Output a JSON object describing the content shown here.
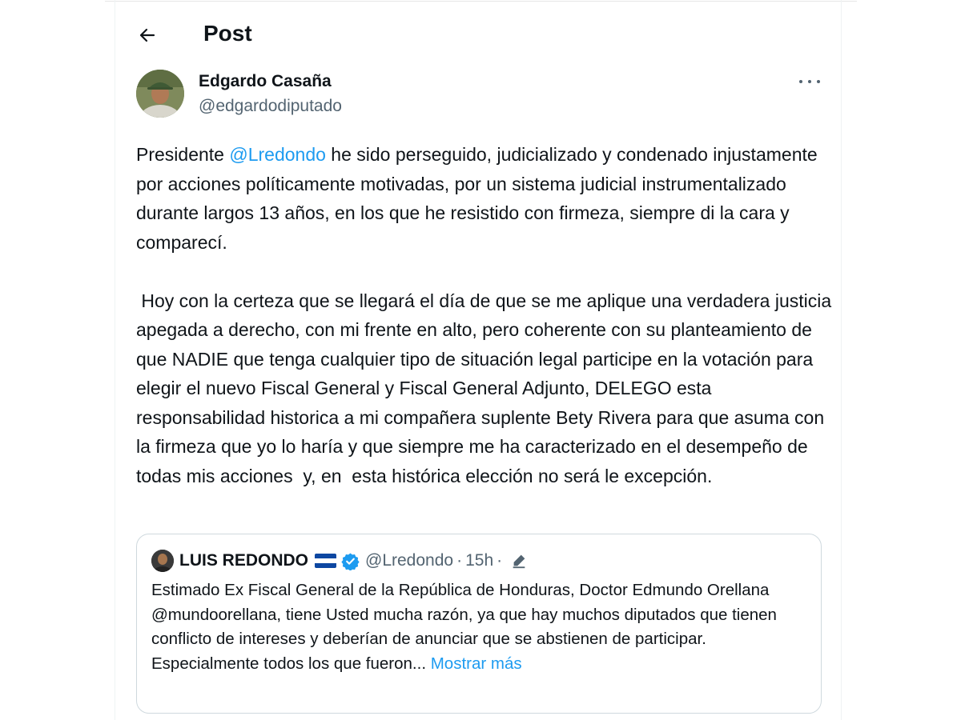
{
  "header": {
    "title": "Post",
    "back_icon": "arrow-left-icon"
  },
  "author": {
    "name": "Edgardo Casaña",
    "handle": "@edgardodiputado"
  },
  "more_icon": "more-horizontal-icon",
  "tweet": {
    "p1_prefix": "Presidente ",
    "p1_mention": "@Lredondo",
    "p1_rest": " he sido perseguido, judicializado y condenado injustamente por acciones políticamente motivadas, por un sistema judicial instrumentalizado durante largos 13 años, en los que he resistido con firmeza, siempre di la cara y comparecí.",
    "p2": " Hoy con la certeza que se llegará el día de que se me aplique una verdadera justicia apegada a derecho, con mi frente en alto, pero coherente con su planteamiento de que NADIE que tenga cualquier tipo de situación legal participe en la votación para elegir el nuevo Fiscal General y Fiscal General Adjunto, DELEGO esta responsabilidad historica a mi compañera suplente Bety Rivera para que asuma con la firmeza que yo lo haría y que siempre me ha caracterizado en el desempeño de todas mis acciones  y, en  esta histórica elección no será le excepción."
  },
  "quote": {
    "name": "LUIS REDONDO",
    "handle": "@Lredondo",
    "separator": "·",
    "time": "15h",
    "line1": "Estimado Ex Fiscal General de la República de Honduras, Doctor Edmundo Orellana @mundoorellana, tiene Usted mucha razón, ya que hay muchos diputados que tienen conflicto de intereses y deberían de anunciar que se abstienen de participar.",
    "line2": "Especialmente todos los que fueron...",
    "show_more": "Mostrar más",
    "flag_colors": [
      "#0d47a1",
      "#ffffff",
      "#0d47a1"
    ],
    "verified_color": "#1d9bf0"
  },
  "colors": {
    "accent": "#1d9bf0",
    "secondary_text": "#536471",
    "border": "#cfd9de"
  }
}
